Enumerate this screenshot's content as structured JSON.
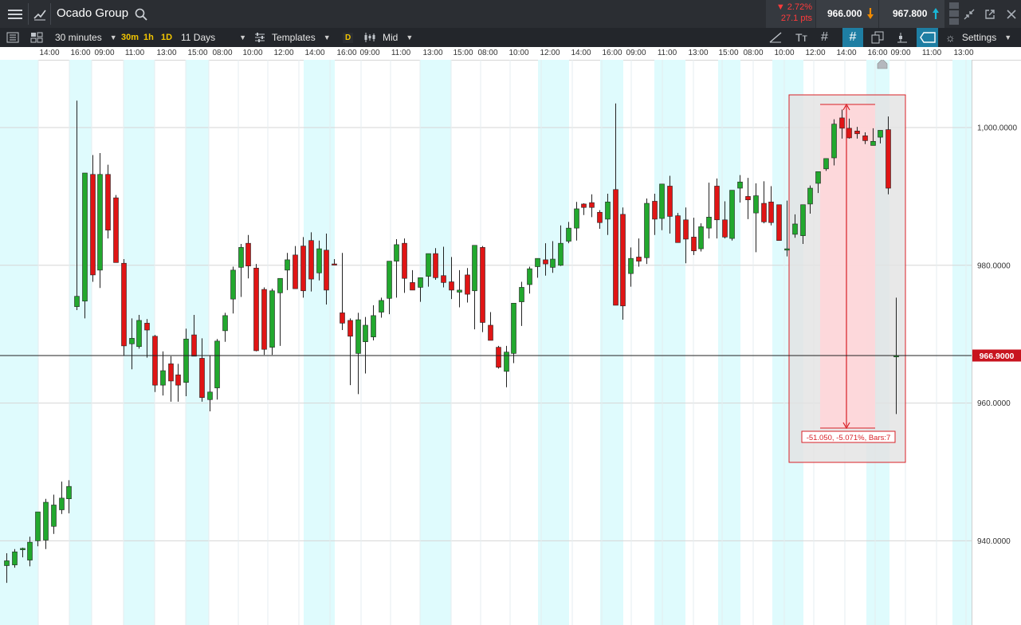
{
  "header": {
    "instrument_name": "Ocado Group",
    "change_percent": "2.72%",
    "change_points": "27.1 pts",
    "sell_price": "966.000",
    "buy_price": "967.800"
  },
  "toolbar": {
    "interval": "30 minutes",
    "quick_intervals": [
      "30m",
      "1h",
      "1D"
    ],
    "range": "11 Days",
    "templates_label": "Templates",
    "d_badge": "D",
    "price_type": "Mid",
    "settings_label": "Settings"
  },
  "time_axis": {
    "labels": [
      "14:00",
      "16:00",
      "09:00",
      "11:00",
      "13:00",
      "15:00",
      "08:00",
      "10:00",
      "12:00",
      "14:00",
      "16:00",
      "09:00",
      "11:00",
      "13:00",
      "15:00",
      "08:00",
      "10:00",
      "12:00",
      "14:00",
      "16:00",
      "09:00",
      "11:00",
      "13:00",
      "15:00",
      "08:00",
      "10:00",
      "12:00",
      "14:00",
      "16:00",
      "09:00",
      "11:00",
      "13:00"
    ]
  },
  "colors": {
    "up": "#22a82e",
    "down": "#e01515",
    "session_band": "#dffbfd",
    "measure_fill": "#ffd6d9",
    "measure_border": "#d81f26",
    "price_marker": "#c8141e",
    "header_bg": "#2b2e33",
    "toolbar_bg": "#23262b"
  },
  "chart_data": {
    "type": "candlestick",
    "yticks": [
      "1,000.0000",
      "980.0000",
      "960.0000",
      "940.0000"
    ],
    "current_price_label": "966.9000",
    "measurement_label": "-51.050, -5.071%, Bars:7",
    "candles": [
      {
        "o": 936.4,
        "h": 938.2,
        "l": 933.9,
        "c": 937.1
      },
      {
        "o": 936.5,
        "h": 938.8,
        "l": 936.1,
        "c": 938.4
      },
      {
        "o": 938.7,
        "h": 939.0,
        "l": 937.6,
        "c": 938.9
      },
      {
        "o": 937.2,
        "h": 940.6,
        "l": 936.3,
        "c": 939.8
      },
      {
        "o": 940.0,
        "h": 944.1,
        "l": 939.2,
        "c": 944.2
      },
      {
        "o": 940.1,
        "h": 946.1,
        "l": 938.8,
        "c": 945.6
      },
      {
        "o": 942.1,
        "h": 946.7,
        "l": 941.0,
        "c": 945.2
      },
      {
        "o": 944.5,
        "h": 948.6,
        "l": 943.9,
        "c": 946.2
      },
      {
        "o": 946.1,
        "h": 948.8,
        "l": 944.0,
        "c": 947.9
      },
      {
        "o": 974.0,
        "h": 1003.9,
        "l": 973.5,
        "c": 975.5
      },
      {
        "o": 974.8,
        "h": 992.0,
        "l": 972.3,
        "c": 993.4
      },
      {
        "o": 993.2,
        "h": 996.0,
        "l": 977.6,
        "c": 978.6
      },
      {
        "o": 979.3,
        "h": 996.3,
        "l": 976.7,
        "c": 993.2
      },
      {
        "o": 993.2,
        "h": 994.6,
        "l": 983.9,
        "c": 985.1
      },
      {
        "o": 989.8,
        "h": 990.2,
        "l": 980.4,
        "c": 980.4
      },
      {
        "o": 980.3,
        "h": 980.9,
        "l": 966.9,
        "c": 968.3
      },
      {
        "o": 968.6,
        "h": 972.3,
        "l": 964.9,
        "c": 969.4
      },
      {
        "o": 968.2,
        "h": 972.8,
        "l": 967.9,
        "c": 972.0
      },
      {
        "o": 971.6,
        "h": 972.2,
        "l": 966.6,
        "c": 970.6
      },
      {
        "o": 969.7,
        "h": 969.9,
        "l": 961.6,
        "c": 962.6
      },
      {
        "o": 962.6,
        "h": 967.5,
        "l": 961.1,
        "c": 964.7
      },
      {
        "o": 965.7,
        "h": 966.8,
        "l": 960.2,
        "c": 963.2
      },
      {
        "o": 964.1,
        "h": 965.7,
        "l": 960.2,
        "c": 962.6
      },
      {
        "o": 963.0,
        "h": 970.8,
        "l": 961.0,
        "c": 969.3
      },
      {
        "o": 969.9,
        "h": 972.8,
        "l": 967.3,
        "c": 966.8
      },
      {
        "o": 966.5,
        "h": 969.4,
        "l": 960.2,
        "c": 960.8
      },
      {
        "o": 960.5,
        "h": 966.9,
        "l": 958.8,
        "c": 961.6
      },
      {
        "o": 962.2,
        "h": 969.3,
        "l": 960.5,
        "c": 969.0
      },
      {
        "o": 970.5,
        "h": 973.1,
        "l": 968.9,
        "c": 972.7
      },
      {
        "o": 975.1,
        "h": 979.8,
        "l": 973.0,
        "c": 979.3
      },
      {
        "o": 979.7,
        "h": 983.1,
        "l": 975.4,
        "c": 982.6
      },
      {
        "o": 983.2,
        "h": 984.4,
        "l": 978.1,
        "c": 979.9
      },
      {
        "o": 979.6,
        "h": 980.2,
        "l": 967.5,
        "c": 967.6
      },
      {
        "o": 976.5,
        "h": 976.8,
        "l": 967.0,
        "c": 967.8
      },
      {
        "o": 968.1,
        "h": 976.6,
        "l": 967.0,
        "c": 976.3
      },
      {
        "o": 976.0,
        "h": 978.1,
        "l": 968.3,
        "c": 978.1
      },
      {
        "o": 979.3,
        "h": 981.8,
        "l": 976.4,
        "c": 980.8
      },
      {
        "o": 981.5,
        "h": 982.8,
        "l": 978.6,
        "c": 976.6
      },
      {
        "o": 982.8,
        "h": 984.1,
        "l": 975.3,
        "c": 976.3
      },
      {
        "o": 983.6,
        "h": 984.8,
        "l": 976.2,
        "c": 978.0
      },
      {
        "o": 978.9,
        "h": 983.6,
        "l": 977.8,
        "c": 982.4
      },
      {
        "o": 982.2,
        "h": 984.6,
        "l": 974.3,
        "c": 976.4
      },
      {
        "o": 980.2,
        "h": 980.9,
        "l": 980.2,
        "c": 980.1
      },
      {
        "o": 973.1,
        "h": 981.8,
        "l": 970.6,
        "c": 971.6
      },
      {
        "o": 972.0,
        "h": 972.3,
        "l": 962.6,
        "c": 969.7
      },
      {
        "o": 967.2,
        "h": 973.1,
        "l": 961.3,
        "c": 972.1
      },
      {
        "o": 968.9,
        "h": 972.5,
        "l": 964.3,
        "c": 971.3
      },
      {
        "o": 969.6,
        "h": 974.2,
        "l": 969.1,
        "c": 972.7
      },
      {
        "o": 973.2,
        "h": 975.3,
        "l": 972.4,
        "c": 974.9
      },
      {
        "o": 975.2,
        "h": 980.5,
        "l": 972.9,
        "c": 980.6
      },
      {
        "o": 980.6,
        "h": 983.8,
        "l": 975.3,
        "c": 983.0
      },
      {
        "o": 983.2,
        "h": 983.9,
        "l": 976.0,
        "c": 978.1
      },
      {
        "o": 977.5,
        "h": 979.3,
        "l": 976.4,
        "c": 976.4
      },
      {
        "o": 976.8,
        "h": 977.5,
        "l": 974.7,
        "c": 978.2
      },
      {
        "o": 978.4,
        "h": 980.7,
        "l": 976.9,
        "c": 981.7
      },
      {
        "o": 981.7,
        "h": 982.5,
        "l": 977.9,
        "c": 978.2
      },
      {
        "o": 978.5,
        "h": 982.7,
        "l": 976.8,
        "c": 977.5
      },
      {
        "o": 977.6,
        "h": 981.2,
        "l": 975.1,
        "c": 976.4
      },
      {
        "o": 976.1,
        "h": 979.3,
        "l": 973.9,
        "c": 976.4
      },
      {
        "o": 978.6,
        "h": 979.6,
        "l": 974.6,
        "c": 975.8
      },
      {
        "o": 976.3,
        "h": 982.9,
        "l": 970.7,
        "c": 982.9
      },
      {
        "o": 982.6,
        "h": 982.8,
        "l": 970.3,
        "c": 971.7
      },
      {
        "o": 971.3,
        "h": 973.2,
        "l": 969.9,
        "c": 969.1
      },
      {
        "o": 968.1,
        "h": 968.3,
        "l": 965.0,
        "c": 965.2
      },
      {
        "o": 964.6,
        "h": 968.3,
        "l": 962.3,
        "c": 967.4
      },
      {
        "o": 967.2,
        "h": 973.4,
        "l": 965.8,
        "c": 974.5
      },
      {
        "o": 974.7,
        "h": 977.6,
        "l": 971.2,
        "c": 976.8
      },
      {
        "o": 977.2,
        "h": 979.8,
        "l": 975.9,
        "c": 979.5
      },
      {
        "o": 979.8,
        "h": 980.3,
        "l": 978.2,
        "c": 981.0
      },
      {
        "o": 980.8,
        "h": 983.2,
        "l": 978.5,
        "c": 980.2
      },
      {
        "o": 979.7,
        "h": 983.5,
        "l": 978.9,
        "c": 980.9
      },
      {
        "o": 980.0,
        "h": 985.8,
        "l": 979.9,
        "c": 983.2
      },
      {
        "o": 983.5,
        "h": 986.3,
        "l": 983.2,
        "c": 985.4
      },
      {
        "o": 985.4,
        "h": 989.2,
        "l": 983.6,
        "c": 988.2
      },
      {
        "o": 988.9,
        "h": 989.0,
        "l": 987.3,
        "c": 988.4
      },
      {
        "o": 989.1,
        "h": 990.3,
        "l": 987.0,
        "c": 988.4
      },
      {
        "o": 987.7,
        "h": 988.0,
        "l": 985.3,
        "c": 986.2
      },
      {
        "o": 986.7,
        "h": 990.4,
        "l": 984.4,
        "c": 989.2
      },
      {
        "o": 991.0,
        "h": 1003.5,
        "l": 974.7,
        "c": 974.2
      },
      {
        "o": 987.4,
        "h": 988.4,
        "l": 972.1,
        "c": 974.1
      },
      {
        "o": 978.8,
        "h": 982.6,
        "l": 976.9,
        "c": 981.0
      },
      {
        "o": 981.2,
        "h": 983.9,
        "l": 979.8,
        "c": 980.6
      },
      {
        "o": 981.1,
        "h": 989.7,
        "l": 980.2,
        "c": 989.0
      },
      {
        "o": 989.3,
        "h": 990.4,
        "l": 984.4,
        "c": 986.7
      },
      {
        "o": 986.8,
        "h": 990.8,
        "l": 985.1,
        "c": 991.8
      },
      {
        "o": 991.5,
        "h": 993.0,
        "l": 984.6,
        "c": 987.1
      },
      {
        "o": 987.2,
        "h": 987.6,
        "l": 983.3,
        "c": 983.3
      },
      {
        "o": 986.6,
        "h": 988.4,
        "l": 980.3,
        "c": 983.8
      },
      {
        "o": 984.1,
        "h": 986.9,
        "l": 981.5,
        "c": 982.1
      },
      {
        "o": 982.4,
        "h": 986.1,
        "l": 982.0,
        "c": 985.6
      },
      {
        "o": 985.4,
        "h": 992.0,
        "l": 983.9,
        "c": 987.0
      },
      {
        "o": 991.5,
        "h": 992.6,
        "l": 983.9,
        "c": 986.6
      },
      {
        "o": 986.6,
        "h": 989.3,
        "l": 983.9,
        "c": 984.1
      },
      {
        "o": 983.9,
        "h": 990.0,
        "l": 983.6,
        "c": 990.9
      },
      {
        "o": 991.2,
        "h": 993.1,
        "l": 989.1,
        "c": 992.1
      },
      {
        "o": 990.0,
        "h": 992.7,
        "l": 986.7,
        "c": 989.5
      },
      {
        "o": 987.6,
        "h": 991.9,
        "l": 981.9,
        "c": 990.1
      },
      {
        "o": 989.0,
        "h": 992.2,
        "l": 986.1,
        "c": 986.3
      },
      {
        "o": 989.2,
        "h": 991.5,
        "l": 985.8,
        "c": 986.2
      },
      {
        "o": 988.8,
        "h": 988.4,
        "l": 983.6,
        "c": 983.6
      },
      {
        "o": 982.2,
        "h": 989.4,
        "l": 981.3,
        "c": 982.4
      },
      {
        "o": 984.5,
        "h": 987.4,
        "l": 984.0,
        "c": 986.0
      },
      {
        "o": 984.3,
        "h": 988.4,
        "l": 983.1,
        "c": 988.8
      },
      {
        "o": 988.9,
        "h": 991.6,
        "l": 987.5,
        "c": 991.2
      },
      {
        "o": 991.9,
        "h": 993.2,
        "l": 990.5,
        "c": 993.6
      },
      {
        "o": 994.0,
        "h": 995.3,
        "l": 993.7,
        "c": 995.5
      },
      {
        "o": 995.6,
        "h": 1001.2,
        "l": 994.5,
        "c": 1000.5
      },
      {
        "o": 1001.4,
        "h": 1002.6,
        "l": 998.4,
        "c": 999.9
      },
      {
        "o": 999.9,
        "h": 1001.3,
        "l": 998.4,
        "c": 998.5
      },
      {
        "o": 999.5,
        "h": 1000.1,
        "l": 998.4,
        "c": 999.1
      },
      {
        "o": 998.8,
        "h": 999.3,
        "l": 997.6,
        "c": 998.1
      },
      {
        "o": 997.4,
        "h": 999.9,
        "l": 997.5,
        "c": 998.0
      },
      {
        "o": 998.6,
        "h": 999.2,
        "l": 997.7,
        "c": 999.6
      },
      {
        "o": 999.7,
        "h": 1001.6,
        "l": 990.3,
        "c": 991.2
      },
      {
        "o": 966.7,
        "h": 975.3,
        "l": 958.4,
        "c": 966.9
      }
    ]
  }
}
